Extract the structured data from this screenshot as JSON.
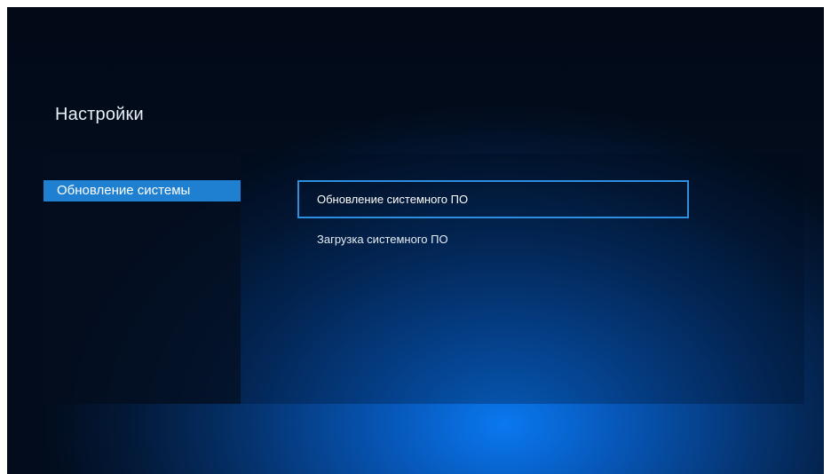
{
  "header": {
    "title": "Настройки"
  },
  "sidebar": {
    "items": [
      {
        "label": "Обновление системы",
        "selected": true
      }
    ]
  },
  "main": {
    "options": [
      {
        "label": "Обновление системного ПО",
        "focused": true
      },
      {
        "label": "Загрузка системного ПО",
        "focused": false
      }
    ]
  },
  "colors": {
    "accent": "#1f7fd0",
    "focus_border": "#2e8fe0",
    "background_glow": "#0a78f0"
  }
}
